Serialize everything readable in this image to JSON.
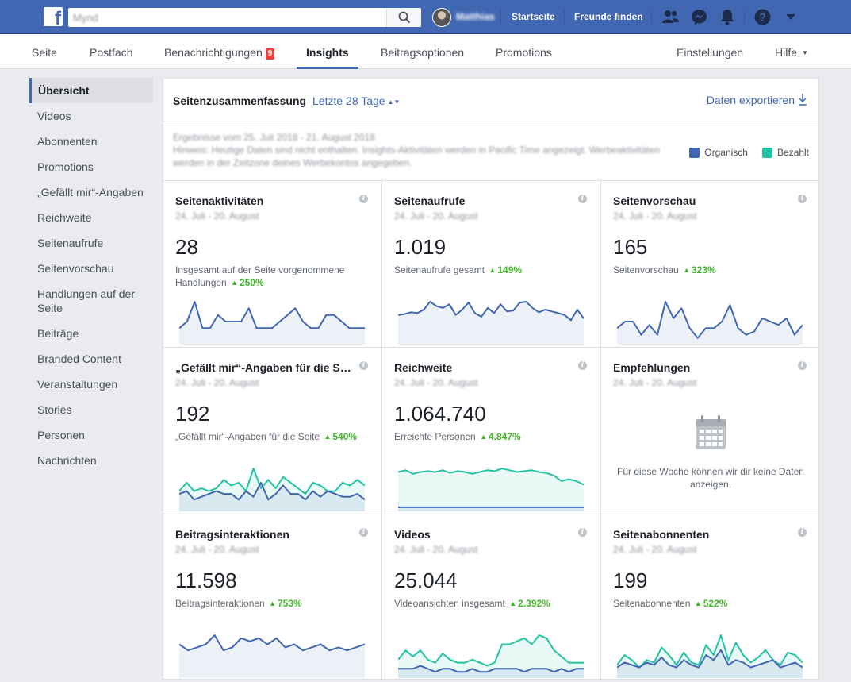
{
  "topbar": {
    "search_value": "Mynd",
    "user_name": "Matthias",
    "links": [
      "Startseite",
      "Freunde finden"
    ],
    "icons": [
      "friends-icon",
      "messenger-icon",
      "notifications-icon",
      "help-icon",
      "account-menu-icon"
    ]
  },
  "subnav": {
    "items": [
      "Seite",
      "Postfach",
      "Benachrichtigungen",
      "Insights",
      "Beitragsoptionen",
      "Promotions"
    ],
    "notification_badge": "9",
    "right_items": [
      "Einstellungen",
      "Hilfe"
    ],
    "active": "Insights"
  },
  "sidebar": {
    "items": [
      "Übersicht",
      "Videos",
      "Abonnenten",
      "Promotions",
      "„Gefällt mir“-Angaben",
      "Reichweite",
      "Seitenaufrufe",
      "Seitenvorschau",
      "Handlungen auf der Seite",
      "Beiträge",
      "Branded Content",
      "Veranstaltungen",
      "Stories",
      "Personen",
      "Nachrichten"
    ],
    "active": "Übersicht"
  },
  "summary": {
    "title": "Seitenzusammenfassung",
    "period": "Letzte 28 Tage",
    "export": "Daten exportieren",
    "info_line1": "Ergebnisse vom 25. Juli 2018 - 21. August 2018",
    "info_line2": "Hinweis: Heutige Daten sind nicht enthalten. Insights-Aktivitäten werden in Pacific Time angezeigt. Werbeaktivitäten werden in der Zeitzone deines Werbekontos angegeben.",
    "legend": [
      {
        "label": "Organisch",
        "color": "#4267b2"
      },
      {
        "label": "Bezahlt",
        "color": "#23c4a3"
      }
    ]
  },
  "cards": [
    {
      "title": "Seitenaktivitäten",
      "date": "24. Juli - 20. August",
      "value": "28",
      "desc": "Insgesamt auf der Seite vorgenommene Handlungen",
      "change": "250%"
    },
    {
      "title": "Seitenaufrufe",
      "date": "24. Juli - 20. August",
      "value": "1.019",
      "desc": "Seitenaufrufe gesamt",
      "change": "149%"
    },
    {
      "title": "Seitenvorschau",
      "date": "24. Juli - 20. August",
      "value": "165",
      "desc": "Seitenvorschau",
      "change": "323%"
    },
    {
      "title": "„Gefällt mir“-Angaben für die Seite",
      "date": "24. Juli - 20. August",
      "value": "192",
      "desc": "„Gefällt mir“-Angaben für die Seite",
      "change": "540%"
    },
    {
      "title": "Reichweite",
      "date": "24. Juli - 20. August",
      "value": "1.064.740",
      "desc": "Erreichte Personen",
      "change": "4.847%"
    },
    {
      "title": "Empfehlungen",
      "date": "24. Juli - 20. August",
      "empty_text": "Für diese Woche können wir dir keine Daten anzeigen."
    },
    {
      "title": "Beitragsinteraktionen",
      "date": "24. Juli - 20. August",
      "value": "11.598",
      "desc": "Beitragsinteraktionen",
      "change": "753%"
    },
    {
      "title": "Videos",
      "date": "24. Juli - 20. August",
      "value": "25.044",
      "desc": "Videoansichten insgesamt",
      "change": "2.392%"
    },
    {
      "title": "Seitenabonnenten",
      "date": "24. Juli - 20. August",
      "value": "199",
      "desc": "Seitenabonnenten",
      "change": "522%"
    }
  ],
  "chart_data": [
    {
      "type": "area",
      "title": "",
      "series": [
        {
          "values": [
            2,
            3,
            6,
            2,
            2,
            4,
            3,
            3,
            3,
            5,
            2,
            2,
            2,
            3,
            4,
            5,
            3,
            2,
            2,
            4,
            4,
            3,
            2,
            2,
            2
          ]
        }
      ]
    },
    {
      "type": "area",
      "title": "",
      "series": [
        {
          "values": [
            30,
            31,
            33,
            32,
            36,
            45,
            40,
            38,
            42,
            30,
            36,
            44,
            32,
            28,
            38,
            32,
            42,
            34,
            35,
            44,
            45,
            38,
            33,
            36,
            34,
            32,
            30,
            24,
            36,
            26
          ]
        }
      ]
    },
    {
      "type": "area",
      "title": "",
      "series": [
        {
          "values": [
            4,
            6,
            6,
            2,
            5,
            2,
            12,
            7,
            10,
            4,
            1,
            4,
            4,
            6,
            11,
            4,
            2,
            3,
            7,
            6,
            5,
            7,
            2,
            5
          ]
        }
      ]
    },
    {
      "type": "area",
      "title": "",
      "series": [
        {
          "values": [
            5,
            6,
            3,
            4,
            5,
            6,
            5,
            5,
            3,
            6,
            4,
            9,
            3,
            5,
            8,
            5,
            5,
            3,
            6,
            4,
            6,
            5,
            4,
            4,
            5,
            3
          ]
        },
        {
          "values": [
            6,
            9,
            6,
            7,
            6,
            7,
            10,
            8,
            9,
            6,
            14,
            7,
            10,
            7,
            11,
            9,
            7,
            5,
            9,
            8,
            6,
            6,
            9,
            8,
            10,
            8
          ]
        }
      ]
    },
    {
      "type": "area",
      "title": "",
      "series": [
        {
          "values": [
            1,
            1,
            1,
            1,
            1,
            1,
            1,
            1,
            1,
            1,
            1,
            1,
            1,
            1,
            1,
            1,
            1,
            1,
            1,
            1,
            1,
            1,
            1,
            1,
            1,
            1
          ]
        },
        {
          "values": [
            40,
            42,
            38,
            40,
            41,
            40,
            42,
            39,
            41,
            40,
            38,
            40,
            42,
            41,
            44,
            42,
            40,
            41,
            42,
            40,
            39,
            36,
            30,
            32,
            30,
            26
          ]
        }
      ]
    },
    {
      "type": "area",
      "title": "",
      "series": [
        {
          "values": [
            10,
            8,
            9,
            10,
            13,
            8,
            9,
            12,
            11,
            12,
            10,
            12,
            9,
            10,
            8,
            9,
            10,
            8,
            9,
            8,
            9,
            10
          ]
        }
      ]
    },
    {
      "type": "area",
      "title": "",
      "series": [
        {
          "values": [
            2,
            2,
            2,
            3,
            2,
            1,
            2,
            2,
            1,
            1,
            2,
            1,
            1,
            2,
            2,
            2,
            2,
            1,
            2,
            2,
            2,
            1,
            2,
            1,
            2,
            2
          ]
        },
        {
          "values": [
            5,
            8,
            6,
            8,
            5,
            4,
            7,
            5,
            4,
            4,
            5,
            4,
            3,
            4,
            10,
            10,
            11,
            12,
            10,
            13,
            12,
            8,
            6,
            4,
            4,
            4
          ]
        }
      ]
    },
    {
      "type": "area",
      "title": "",
      "series": [
        {
          "values": [
            3,
            5,
            4,
            3,
            5,
            4,
            7,
            4,
            3,
            6,
            4,
            3,
            8,
            6,
            10,
            4,
            6,
            5,
            3,
            4,
            5,
            6,
            3,
            4,
            5,
            3
          ]
        },
        {
          "values": [
            4,
            8,
            6,
            3,
            6,
            5,
            11,
            8,
            4,
            9,
            5,
            4,
            12,
            8,
            16,
            6,
            13,
            8,
            5,
            7,
            10,
            6,
            4,
            9,
            8,
            5
          ]
        }
      ]
    }
  ]
}
